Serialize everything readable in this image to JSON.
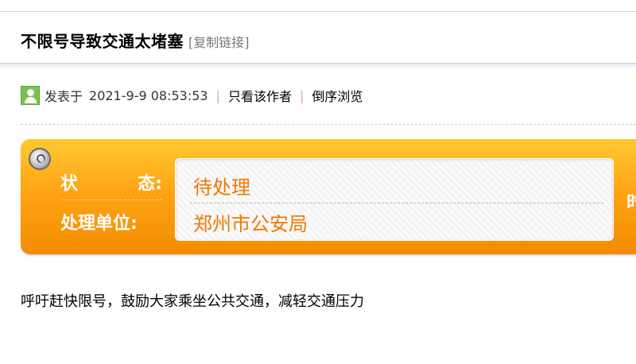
{
  "thread": {
    "title": "不限号导致交通太堵塞",
    "copy_link_label": "[复制链接]"
  },
  "meta": {
    "posted_label": "发表于",
    "posted_time": "2021-9-9 08:53:53",
    "separator": "|",
    "only_author_label": "只看该作者",
    "reverse_order_label": "倒序浏览"
  },
  "status_panel": {
    "status_label_1": "状",
    "status_label_2": "态:",
    "status_value": "待处理",
    "unit_label": "处理单位:",
    "unit_value": "郑州市公安局",
    "cut_off_char": "时",
    "colors": {
      "panel_top": "#ffc933",
      "panel_bottom": "#f38b00",
      "value_text": "#f07800"
    }
  },
  "post": {
    "body": "呼吁赶快限号，鼓励大家乘坐公共交通，减轻交通压力"
  }
}
